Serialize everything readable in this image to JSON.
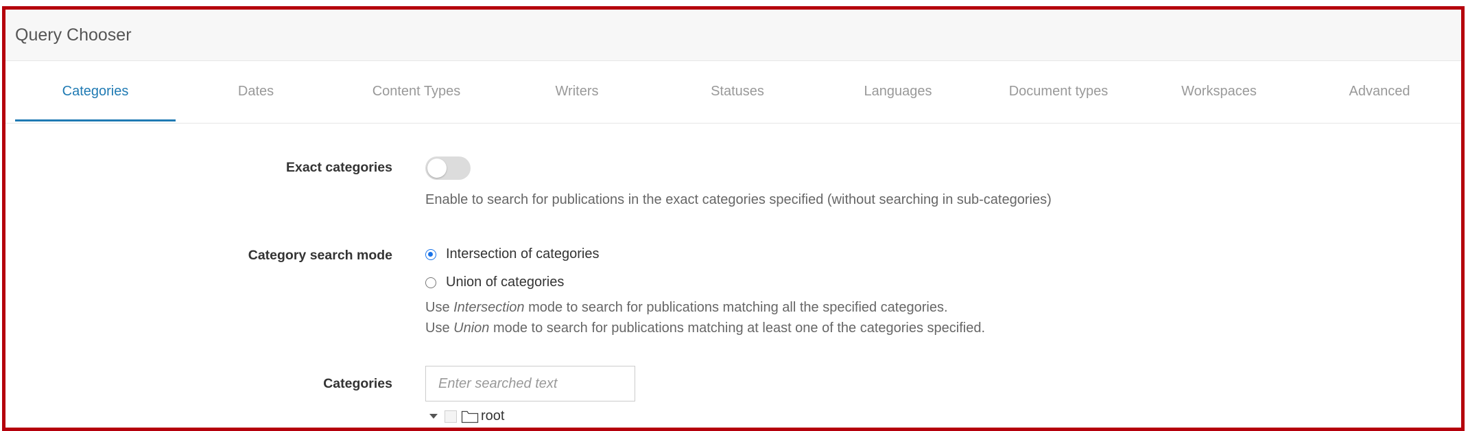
{
  "header": {
    "title": "Query Chooser"
  },
  "tabs": [
    {
      "label": "Categories",
      "active": true
    },
    {
      "label": "Dates"
    },
    {
      "label": "Content Types"
    },
    {
      "label": "Writers"
    },
    {
      "label": "Statuses"
    },
    {
      "label": "Languages"
    },
    {
      "label": "Document types"
    },
    {
      "label": "Workspaces"
    },
    {
      "label": "Advanced"
    }
  ],
  "exact_categories": {
    "label": "Exact categories",
    "enabled": false,
    "help": "Enable to search for publications in the exact categories specified (without searching in sub-categories)"
  },
  "category_search_mode": {
    "label": "Category search mode",
    "options": [
      {
        "label": "Intersection of categories",
        "selected": true
      },
      {
        "label": "Union of categories",
        "selected": false
      }
    ],
    "help_line1_prefix": "Use ",
    "help_line1_em": "Intersection",
    "help_line1_suffix": " mode to search for publications matching all the specified categories.",
    "help_line2_prefix": "Use ",
    "help_line2_em": "Union",
    "help_line2_suffix": " mode to search for publications matching at least one of the categories specified."
  },
  "categories": {
    "label": "Categories",
    "search_placeholder": "Enter searched text",
    "search_value": "",
    "tree_root": "root"
  },
  "colors": {
    "accent": "#1f7ab3",
    "frame": "#b5000c",
    "radio_selected": "#1a73e8"
  },
  "icons": [
    "caret-down-icon",
    "checkbox-icon",
    "folder-icon"
  ]
}
